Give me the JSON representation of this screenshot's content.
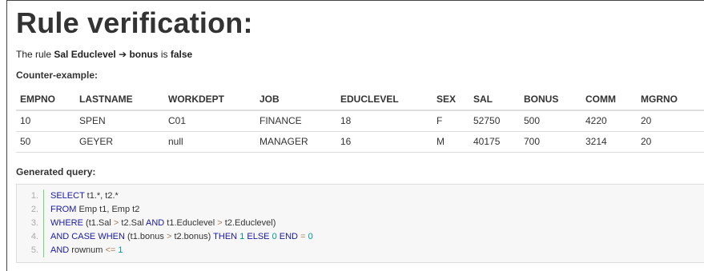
{
  "page": {
    "title": "Rule verification:",
    "rule_prefix": "The rule",
    "rule_text": "Sal Educlevel ➔ bonus",
    "rule_mid": "is",
    "rule_result": "false"
  },
  "counter_example": {
    "label": "Counter-example:",
    "columns": [
      "EMPNO",
      "LASTNAME",
      "WORKDEPT",
      "JOB",
      "EDUCLEVEL",
      "SEX",
      "SAL",
      "BONUS",
      "COMM",
      "MGRNO"
    ],
    "rows": [
      [
        "10",
        "SPEN",
        "C01",
        "FINANCE",
        "18",
        "F",
        "52750",
        "500",
        "4220",
        "20"
      ],
      [
        "50",
        "GEYER",
        "null",
        "MANAGER",
        "16",
        "M",
        "40175",
        "700",
        "3214",
        "20"
      ]
    ]
  },
  "query": {
    "label": "Generated query:",
    "lines": [
      {
        "no": "1.",
        "text": "SELECT t1.*, t2.*"
      },
      {
        "no": "2.",
        "text": "FROM Emp t1, Emp t2"
      },
      {
        "no": "3.",
        "text": "WHERE (t1.Sal > t2.Sal AND t1.Educlevel > t2.Educlevel)"
      },
      {
        "no": "4.",
        "text": "AND CASE WHEN (t1.bonus > t2.bonus) THEN 1 ELSE 0 END = 0"
      },
      {
        "no": "5.",
        "text": "AND rownum <= 1"
      }
    ]
  }
}
